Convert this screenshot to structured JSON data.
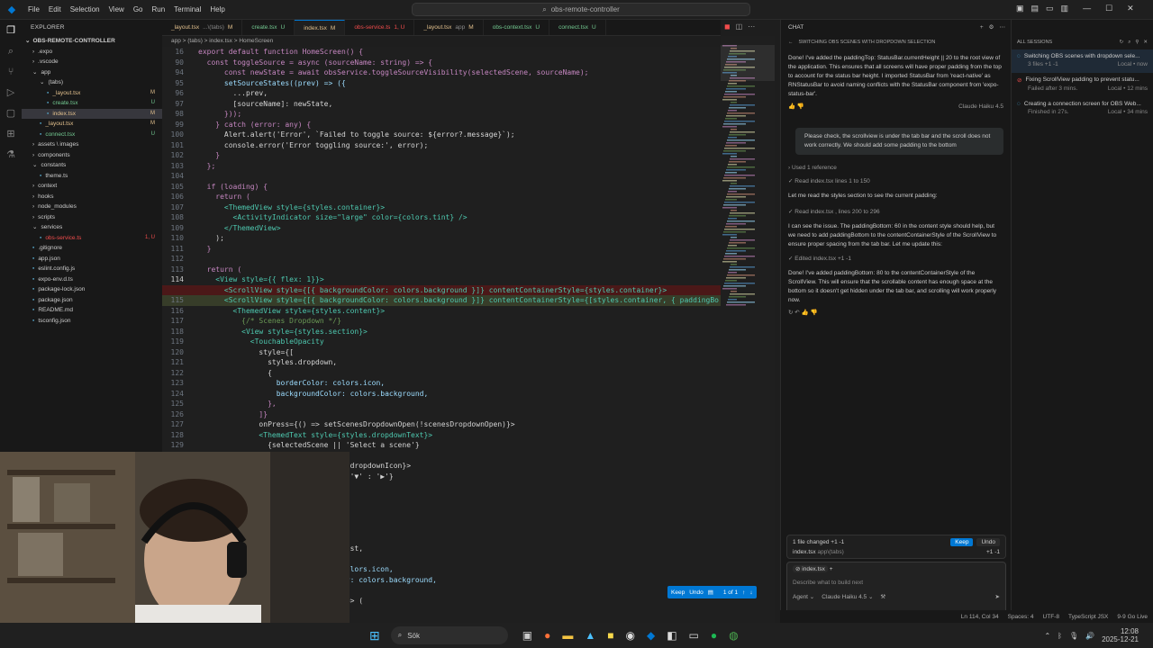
{
  "titlebar": {
    "menu": [
      "File",
      "Edit",
      "Selection",
      "View",
      "Go",
      "Run",
      "Terminal",
      "Help"
    ],
    "search": "obs-remote-controller"
  },
  "explorer": {
    "header": "EXPLORER",
    "root": "OBS-REMOTE-CONTROLLER",
    "items": [
      {
        "label": ".expo",
        "depth": 1,
        "kind": "folder",
        "status": ""
      },
      {
        "label": ".vscode",
        "depth": 1,
        "kind": "folder",
        "status": ""
      },
      {
        "label": "app",
        "depth": 1,
        "kind": "folder-open",
        "status": ""
      },
      {
        "label": "(tabs)",
        "depth": 2,
        "kind": "folder-open",
        "status": ""
      },
      {
        "label": "_layout.tsx",
        "depth": 3,
        "kind": "file",
        "status": "M"
      },
      {
        "label": "create.tsx",
        "depth": 3,
        "kind": "file",
        "status": "U"
      },
      {
        "label": "index.tsx",
        "depth": 3,
        "kind": "file",
        "status": "M",
        "selected": true
      },
      {
        "label": "_layout.tsx",
        "depth": 2,
        "kind": "file",
        "status": "M"
      },
      {
        "label": "connect.tsx",
        "depth": 2,
        "kind": "file",
        "status": "U"
      },
      {
        "label": "assets \\ images",
        "depth": 1,
        "kind": "folder",
        "status": ""
      },
      {
        "label": "components",
        "depth": 1,
        "kind": "folder",
        "status": ""
      },
      {
        "label": "constants",
        "depth": 1,
        "kind": "folder-open",
        "status": ""
      },
      {
        "label": "theme.ts",
        "depth": 2,
        "kind": "file",
        "status": ""
      },
      {
        "label": "context",
        "depth": 1,
        "kind": "folder",
        "status": ""
      },
      {
        "label": "hooks",
        "depth": 1,
        "kind": "folder",
        "status": ""
      },
      {
        "label": "node_modules",
        "depth": 1,
        "kind": "folder",
        "status": ""
      },
      {
        "label": "scripts",
        "depth": 1,
        "kind": "folder",
        "status": ""
      },
      {
        "label": "services",
        "depth": 1,
        "kind": "folder-open",
        "status": ""
      },
      {
        "label": "obs-service.ts",
        "depth": 2,
        "kind": "file",
        "status": "1, U"
      },
      {
        "label": ".gitignore",
        "depth": 1,
        "kind": "file",
        "status": ""
      },
      {
        "label": "app.json",
        "depth": 1,
        "kind": "file",
        "status": ""
      },
      {
        "label": "eslint.config.js",
        "depth": 1,
        "kind": "file",
        "status": ""
      },
      {
        "label": "expo-env.d.ts",
        "depth": 1,
        "kind": "file",
        "status": ""
      },
      {
        "label": "package-lock.json",
        "depth": 1,
        "kind": "file",
        "status": ""
      },
      {
        "label": "package.json",
        "depth": 1,
        "kind": "file",
        "status": ""
      },
      {
        "label": "README.md",
        "depth": 1,
        "kind": "file",
        "status": ""
      },
      {
        "label": "tsconfig.json",
        "depth": 1,
        "kind": "file",
        "status": ""
      }
    ]
  },
  "tabs": [
    {
      "label": "_layout.tsx",
      "sub": "...\\(tabs)",
      "status": "M",
      "active": false
    },
    {
      "label": "create.tsx",
      "sub": "",
      "status": "U",
      "active": false
    },
    {
      "label": "index.tsx",
      "sub": "",
      "status": "M",
      "active": true
    },
    {
      "label": "obs-service.ts",
      "sub": "",
      "status": "1, U",
      "active": false
    },
    {
      "label": "_layout.tsx",
      "sub": "app",
      "status": "M",
      "active": false
    },
    {
      "label": "obs-context.tsx",
      "sub": "",
      "status": "U",
      "active": false
    },
    {
      "label": "connect.tsx",
      "sub": "",
      "status": "U",
      "active": false
    }
  ],
  "breadcrumb": "app > (tabs) > index.tsx > HomeScreen",
  "editor": {
    "lines": [
      {
        "n": "16",
        "text": "export default function HomeScreen() {",
        "cls": ""
      },
      {
        "n": "90",
        "text": "  const toggleSource = async (sourceName: string) => {",
        "cls": ""
      },
      {
        "n": "94",
        "text": "      const newState = await obsService.toggleSourceVisibility(selectedScene, sourceName);",
        "cls": ""
      },
      {
        "n": "95",
        "text": "      setSourceStates((prev) => ({",
        "cls": ""
      },
      {
        "n": "96",
        "text": "        ...prev,",
        "cls": ""
      },
      {
        "n": "97",
        "text": "        [sourceName]: newState,",
        "cls": ""
      },
      {
        "n": "98",
        "text": "      }));",
        "cls": ""
      },
      {
        "n": "99",
        "text": "    } catch (error: any) {",
        "cls": ""
      },
      {
        "n": "100",
        "text": "      Alert.alert('Error', `Failed to toggle source: ${error?.message}`);",
        "cls": ""
      },
      {
        "n": "101",
        "text": "      console.error('Error toggling source:', error);",
        "cls": ""
      },
      {
        "n": "102",
        "text": "    }",
        "cls": ""
      },
      {
        "n": "103",
        "text": "  };",
        "cls": ""
      },
      {
        "n": "104",
        "text": "",
        "cls": ""
      },
      {
        "n": "105",
        "text": "  if (loading) {",
        "cls": ""
      },
      {
        "n": "106",
        "text": "    return (",
        "cls": ""
      },
      {
        "n": "107",
        "text": "      <ThemedView style={styles.container}>",
        "cls": ""
      },
      {
        "n": "108",
        "text": "        <ActivityIndicator size=\"large\" color={colors.tint} />",
        "cls": ""
      },
      {
        "n": "109",
        "text": "      </ThemedView>",
        "cls": ""
      },
      {
        "n": "110",
        "text": "    );",
        "cls": ""
      },
      {
        "n": "111",
        "text": "  }",
        "cls": ""
      },
      {
        "n": "112",
        "text": "",
        "cls": ""
      },
      {
        "n": "113",
        "text": "  return (",
        "cls": ""
      },
      {
        "n": "114",
        "text": "    <View style={{ flex: 1}}>",
        "cls": "cur"
      },
      {
        "n": "",
        "text": "      <ScrollView style={[{ backgroundColor: colors.background }]} contentContainerStyle={styles.container}>",
        "cls": "del"
      },
      {
        "n": "115",
        "text": "      <ScrollView style={[{ backgroundColor: colors.background }]} contentContainerStyle={[styles.container, { paddingBo",
        "cls": "add"
      },
      {
        "n": "116",
        "text": "        <ThemedView style={styles.content}>",
        "cls": ""
      },
      {
        "n": "117",
        "text": "          {/* Scenes Dropdown */}",
        "cls": ""
      },
      {
        "n": "118",
        "text": "          <View style={styles.section}>",
        "cls": ""
      },
      {
        "n": "119",
        "text": "            <TouchableOpacity",
        "cls": ""
      },
      {
        "n": "120",
        "text": "              style={[",
        "cls": ""
      },
      {
        "n": "121",
        "text": "                styles.dropdown,",
        "cls": ""
      },
      {
        "n": "122",
        "text": "                {",
        "cls": ""
      },
      {
        "n": "123",
        "text": "                  borderColor: colors.icon,",
        "cls": ""
      },
      {
        "n": "124",
        "text": "                  backgroundColor: colors.background,",
        "cls": ""
      },
      {
        "n": "125",
        "text": "                },",
        "cls": ""
      },
      {
        "n": "126",
        "text": "              ]}",
        "cls": ""
      },
      {
        "n": "127",
        "text": "              onPress={() => setScenesDropdownOpen(!scenesDropdownOpen)}>",
        "cls": ""
      },
      {
        "n": "128",
        "text": "              <ThemedText style={styles.dropdownText}>",
        "cls": ""
      },
      {
        "n": "129",
        "text": "                {selectedScene || 'Select a scene'}",
        "cls": ""
      },
      {
        "n": "",
        "text": "                  Text>",
        "cls": ""
      },
      {
        "n": "",
        "text": "                  xt style={styles.dropdownIcon}>",
        "cls": ""
      },
      {
        "n": "",
        "text": "                  esDropdownOpen ? '▼' : '▶'}",
        "cls": ""
      },
      {
        "n": "",
        "text": "                  Text>",
        "cls": ""
      },
      {
        "n": "",
        "text": "                  pacity>",
        "cls": ""
      },
      {
        "n": "",
        "text": "",
        "cls": ""
      },
      {
        "n": "",
        "text": "                  ownOpen && (",
        "cls": ""
      },
      {
        "n": "",
        "text": "",
        "cls": ""
      },
      {
        "n": "",
        "text": "                  ={[",
        "cls": ""
      },
      {
        "n": "",
        "text": "                  styles.dropdownList,",
        "cls": ""
      },
      {
        "n": "",
        "text": "",
        "cls": ""
      },
      {
        "n": "",
        "text": "                    borderColor: colors.icon,",
        "cls": ""
      },
      {
        "n": "",
        "text": "                    backgroundColor: colors.background,",
        "cls": ""
      },
      {
        "n": "",
        "text": "",
        "cls": ""
      },
      {
        "n": "",
        "text": "                  nes.map((scene) => (",
        "cls": ""
      }
    ],
    "diff_bar": {
      "keep": "Keep",
      "undo": "Undo",
      "count": "1 of 1"
    }
  },
  "chat": {
    "title": "CHAT",
    "thread_title": "SWITCHING OBS SCENES WITH DROPDOWN SELECTION",
    "msg1": "Done! I've added the  paddingTop: StatusBar.currentHeight || 20  to the root view of the application. This ensures that all screens will have proper padding from the top to account for the status bar height. I imported  StatusBar  from 'react-native' as  RNStatusBar  to avoid naming conflicts with the StatusBar component from 'expo-status-bar'.",
    "model": "Claude Haiku 4.5",
    "user_msg": "Please check, the scrollview is under the tab bar and the scroll does not work correctly. We should add some padding to the bottom",
    "used_ref": "Used 1 reference",
    "read1": "Read index.tsx lines 1 to 150",
    "msg2": "Let me read the styles section to see the current padding:",
    "read2": "Read  index.tsx , lines 200 to 296",
    "msg3": "I can see the issue. The  paddingBottom: 60  in the content style should help, but we need to add  paddingBottom  to the  contentContainerStyle  of the ScrollView to ensure proper spacing from the tab bar. Let me update this:",
    "edited": "Edited  index.tsx  +1 -1",
    "msg4": "Done! I've added  paddingBottom: 80  to the  contentContainerStyle  of the ScrollView. This will ensure that the scrollable content has enough space at the bottom so it doesn't get hidden under the tab bar, and scrolling will work properly now.",
    "files_changed": "1 file changed  +1 -1",
    "keep": "Keep",
    "undo": "Undo",
    "changed_file": "index.tsx",
    "changed_path": "app\\(tabs)",
    "changed_diff": "+1 -1",
    "context_file": "index.tsx",
    "input_placeholder": "Describe what to build next",
    "agent": "Agent",
    "input_model": "Claude Haiku 4.5"
  },
  "sessions": {
    "title": "ALL SESSIONS",
    "items": [
      {
        "title": "Switching OBS scenes with dropdown sele...",
        "meta": "3 files +1 -1",
        "where": "Local • now"
      },
      {
        "title": "Fixing ScrollView padding to prevent statu...",
        "meta": "Failed after 3 mins.",
        "where": "Local • 12 mins"
      },
      {
        "title": "Creating a connection screen for OBS Web...",
        "meta": "Finished in 27s.",
        "where": "Local • 34 mins"
      }
    ]
  },
  "statusbar": {
    "position": "Ln 114, Col 34",
    "spaces": "Spaces: 4",
    "encoding": "UTF-8",
    "lang": "TypeScript JSX",
    "ts": "9-9 Go Live"
  },
  "taskbar": {
    "search": "Sök",
    "time": "12:08",
    "date": "2025-12-21"
  },
  "colors": {
    "accent": "#0078d4",
    "modified": "#e2c08d",
    "untracked": "#73c991",
    "error": "#f14c4c"
  }
}
